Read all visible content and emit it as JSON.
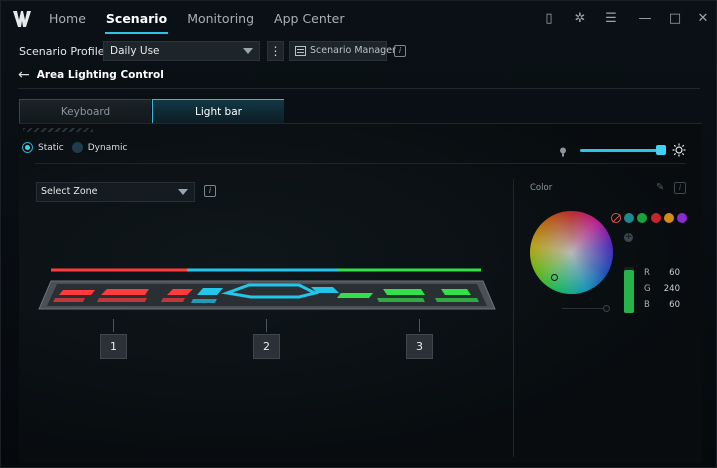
{
  "nav": {
    "tabs": [
      "Home",
      "Scenario",
      "Monitoring",
      "App Center"
    ],
    "active": "Scenario"
  },
  "window_icons": [
    "mouse-icon",
    "settings-gear-icon",
    "list-panel-icon",
    "minimize-icon",
    "maximize-icon",
    "close-icon"
  ],
  "window_glyphs": {
    "mouse": "▯",
    "gear": "✲",
    "list": "☰",
    "min": "—",
    "max": "□",
    "close": "✕"
  },
  "profile": {
    "label": "Scenario Profile",
    "value": "Daily Use",
    "manager_label": "Scenario Manager",
    "kebab": "⋮",
    "info": "i"
  },
  "page": {
    "back_arrow": "←",
    "title": "Area Lighting Control"
  },
  "tabs": {
    "keyboard": "Keyboard",
    "lightbar": "Light bar",
    "selected": "Light bar"
  },
  "mode": {
    "static_label": "Static",
    "dynamic_label": "Dynamic",
    "selected": "Static"
  },
  "brightness": {
    "level_percent": 100
  },
  "zone": {
    "placeholder": "Select Zone",
    "info": "i",
    "labels": [
      "1",
      "2",
      "3"
    ],
    "zone_colors": [
      "#ff3b3b",
      "#22c6ea",
      "#33e04a"
    ]
  },
  "color": {
    "title": "Color",
    "swatches": [
      "none",
      "#1a8a8e",
      "#1aa23a",
      "#c8242c",
      "#d38a16",
      "#8a2ad0"
    ],
    "add": "+",
    "r_label": "R",
    "r": "60",
    "g_label": "G",
    "g": "240",
    "b_label": "B",
    "b": "60",
    "selected_hex": "#3cf03c"
  },
  "accent": "#2ec4e8"
}
